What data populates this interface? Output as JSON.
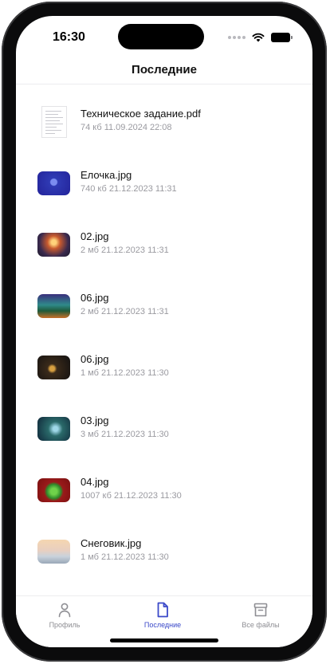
{
  "status_bar": {
    "time": "16:30",
    "icons": [
      "signal-dots",
      "wifi-icon",
      "battery-icon"
    ]
  },
  "header": {
    "title": "Последние"
  },
  "files": [
    {
      "name": "Техническое задание.pdf",
      "meta": "74 кб 11.09.2024 22:08",
      "thumb": "document"
    },
    {
      "name": "Елочка.jpg",
      "meta": "740 кб 21.12.2023 11:31",
      "thumb": "image"
    },
    {
      "name": "02.jpg",
      "meta": "2 мб 21.12.2023 11:31",
      "thumb": "image"
    },
    {
      "name": "06.jpg",
      "meta": "2 мб 21.12.2023 11:31",
      "thumb": "image"
    },
    {
      "name": "06.jpg",
      "meta": "1 мб 21.12.2023 11:30",
      "thumb": "image"
    },
    {
      "name": "03.jpg",
      "meta": "3 мб 21.12.2023 11:30",
      "thumb": "image"
    },
    {
      "name": "04.jpg",
      "meta": "1007 кб 21.12.2023 11:30",
      "thumb": "image"
    },
    {
      "name": "Снеговик.jpg",
      "meta": "1 мб 21.12.2023 11:30",
      "thumb": "image"
    }
  ],
  "tabs": [
    {
      "label": "Профиль",
      "icon": "person-icon",
      "active": false
    },
    {
      "label": "Последние",
      "icon": "document-icon",
      "active": true
    },
    {
      "label": "Все файлы",
      "icon": "archive-icon",
      "active": false
    }
  ],
  "colors": {
    "accent": "#3b49c9",
    "inactive": "#8e8e93",
    "meta_text": "#9a9aa0",
    "background": "#ffffff"
  }
}
